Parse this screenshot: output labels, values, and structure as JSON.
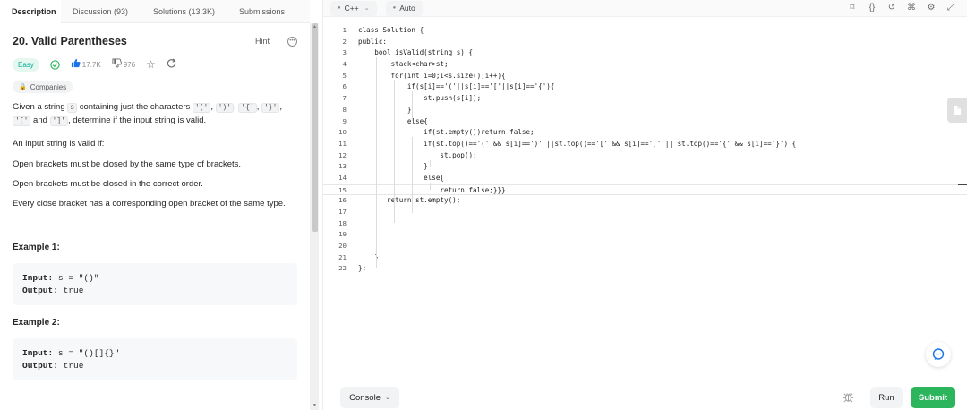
{
  "left": {
    "tabs": [
      "Description",
      "Discussion (93)",
      "Solutions (13.3K)",
      "Submissions"
    ],
    "title": "20. Valid Parentheses",
    "hint": "Hint",
    "difficulty": "Easy",
    "likes": "17.7K",
    "dislikes": "976",
    "companies": "Companies",
    "desc_parts": [
      "Given a string ",
      "s",
      " containing just the characters ",
      "'('",
      ", ",
      "')'",
      ", ",
      "'{'",
      ", ",
      "'}'",
      ",",
      "'['",
      " and ",
      "']'",
      ", determine if the input string is valid."
    ],
    "valid_intro": "An input string is valid if:",
    "rules": [
      "Open brackets must be closed by the same type of brackets.",
      "Open brackets must be closed in the correct order.",
      "Every close bracket has a corresponding open bracket of the same type."
    ],
    "examples": [
      {
        "title": "Example 1:",
        "input_label": "Input:",
        "input": " s = \"()\"",
        "output_label": "Output:",
        "output": " true"
      },
      {
        "title": "Example 2:",
        "input_label": "Input:",
        "input": " s = \"()[]{}\"",
        "output_label": "Output:",
        "output": " true"
      }
    ]
  },
  "right": {
    "language": "C++",
    "mode": "Auto",
    "code_lines": [
      "class Solution {",
      "public:",
      "    bool isValid(string s) {",
      "        stack<char>st;",
      "        for(int i=0;i<s.size();i++){",
      "            if(s[i]=='('||s[i]=='['||s[i]=='{'){",
      "                st.push(s[i]);",
      "            }",
      "            else{",
      "                if(st.empty())return false;",
      "                if(st.top()=='(' && s[i]==')' ||st.top()=='[' && s[i]==']' || st.top()=='{' && s[i]=='}') {",
      "                    st.pop();",
      "                }",
      "                else{",
      "                    return false;}}}",
      "       return st.empty();",
      "",
      "",
      "",
      "",
      "    }",
      "};"
    ],
    "console_label": "Console",
    "run_label": "Run",
    "submit_label": "Submit"
  }
}
